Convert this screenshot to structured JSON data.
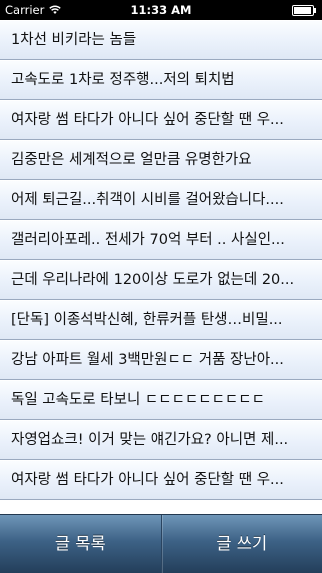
{
  "status_bar": {
    "carrier": "Carrier",
    "time": "11:33 AM"
  },
  "posts": [
    "1차선 비키라는 놈들",
    "고속도로 1차로 정주행...저의 퇴치법",
    "여자랑 썸 타다가 아니다 싶어 중단할 땐 우...",
    "김중만은 세계적으로 얼만큼 유명한가요",
    "어제 퇴근길...취객이 시비를 걸어왔습니다....",
    "갤러리아포레.. 전세가 70억 부터 .. 사실인...",
    "근데 우리나라에 120이상 도로가 없는데 20...",
    "[단독] 이종석박신혜, 한류커플 탄생…비밀...",
    "강남 아파트 월세 3백만원ㄷㄷ  거품 장난아...",
    "독일 고속도로 타보니 ㄷㄷㄷㄷㄷㄷㄷㄷㄷ",
    "자영업쇼크! 이거 맞는 얘긴가요? 아니면 제...",
    "여자랑 썸 타다가 아니다 싶어 중단할 땐 우..."
  ],
  "toolbar": {
    "list_label": "글 목록",
    "write_label": "글 쓰기"
  },
  "colors": {
    "toolbar": "#3d6286",
    "row_background": "#eaf1fb",
    "row_divider": "#9aa9bf"
  }
}
